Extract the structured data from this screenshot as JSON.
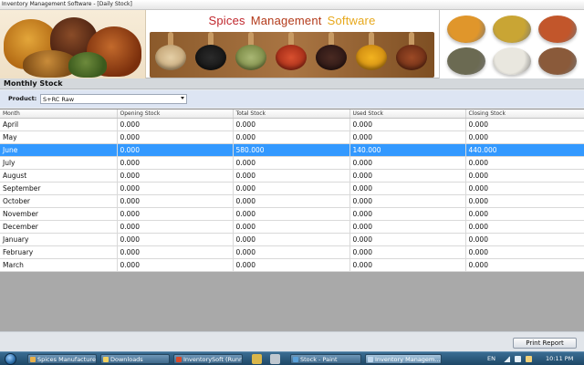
{
  "window": {
    "title": "Inventory Management Software - [Daily Stock]"
  },
  "banner": {
    "title_words": [
      "Spices",
      "Management",
      "Software"
    ],
    "swatch_colors": [
      "#e0962b",
      "#c9a534",
      "#c2562b",
      "#6b6a52",
      "#e9e7df",
      "#8a5a3a"
    ]
  },
  "section": {
    "title": "Monthly Stock"
  },
  "filter": {
    "label": "Product:",
    "value": "S+RC Raw"
  },
  "table": {
    "headers": [
      "Month",
      "Opening Stock",
      "Total Stock",
      "Used Stock",
      "Closing Stock"
    ],
    "rows": [
      [
        "April",
        "0.000",
        "0.000",
        "0.000",
        "0.000"
      ],
      [
        "May",
        "0.000",
        "0.000",
        "0.000",
        "0.000"
      ],
      [
        "June",
        "0.000",
        "580.000",
        "140.000",
        "440.000"
      ],
      [
        "July",
        "0.000",
        "0.000",
        "0.000",
        "0.000"
      ],
      [
        "August",
        "0.000",
        "0.000",
        "0.000",
        "0.000"
      ],
      [
        "September",
        "0.000",
        "0.000",
        "0.000",
        "0.000"
      ],
      [
        "October",
        "0.000",
        "0.000",
        "0.000",
        "0.000"
      ],
      [
        "November",
        "0.000",
        "0.000",
        "0.000",
        "0.000"
      ],
      [
        "December",
        "0.000",
        "0.000",
        "0.000",
        "0.000"
      ],
      [
        "January",
        "0.000",
        "0.000",
        "0.000",
        "0.000"
      ],
      [
        "February",
        "0.000",
        "0.000",
        "0.000",
        "0.000"
      ],
      [
        "March",
        "0.000",
        "0.000",
        "0.000",
        "0.000"
      ]
    ],
    "selected_row": 2,
    "selection_color": "#3399ff"
  },
  "actions": {
    "print_label": "Print Report"
  },
  "taskbar": {
    "items": [
      {
        "label": "Spices Manufacturer...",
        "icon": "app-icon",
        "active": false
      },
      {
        "label": "Downloads",
        "icon": "folder-icon",
        "active": false
      },
      {
        "label": "InventorySoft (Runni...",
        "icon": "app-icon",
        "active": false
      },
      {
        "label": "Stock - Paint",
        "icon": "paint-icon",
        "active": false
      },
      {
        "label": "Inventory Managem...",
        "icon": "window-icon",
        "active": true
      }
    ],
    "language": "EN",
    "time": "10:11 PM"
  }
}
